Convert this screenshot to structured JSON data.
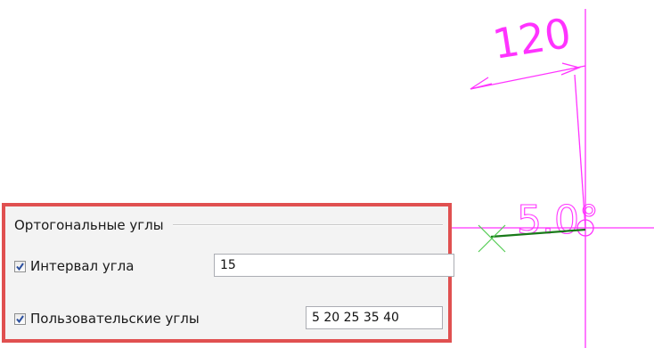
{
  "drawing": {
    "dimension_value": "120",
    "angle_value": "5.0°",
    "colors": {
      "dimension": "#ff33ff",
      "polyline": "#1a7a1a",
      "cursor_cross": "#55cc55"
    }
  },
  "settings_panel": {
    "group_title": "Ортогональные углы",
    "angle_interval": {
      "checked": true,
      "label": "Интервал угла",
      "value": "15"
    },
    "custom_angles": {
      "checked": true,
      "label": "Пользовательские углы",
      "value": "5 20 25 35 40"
    },
    "highlight_color": "#e05050"
  }
}
